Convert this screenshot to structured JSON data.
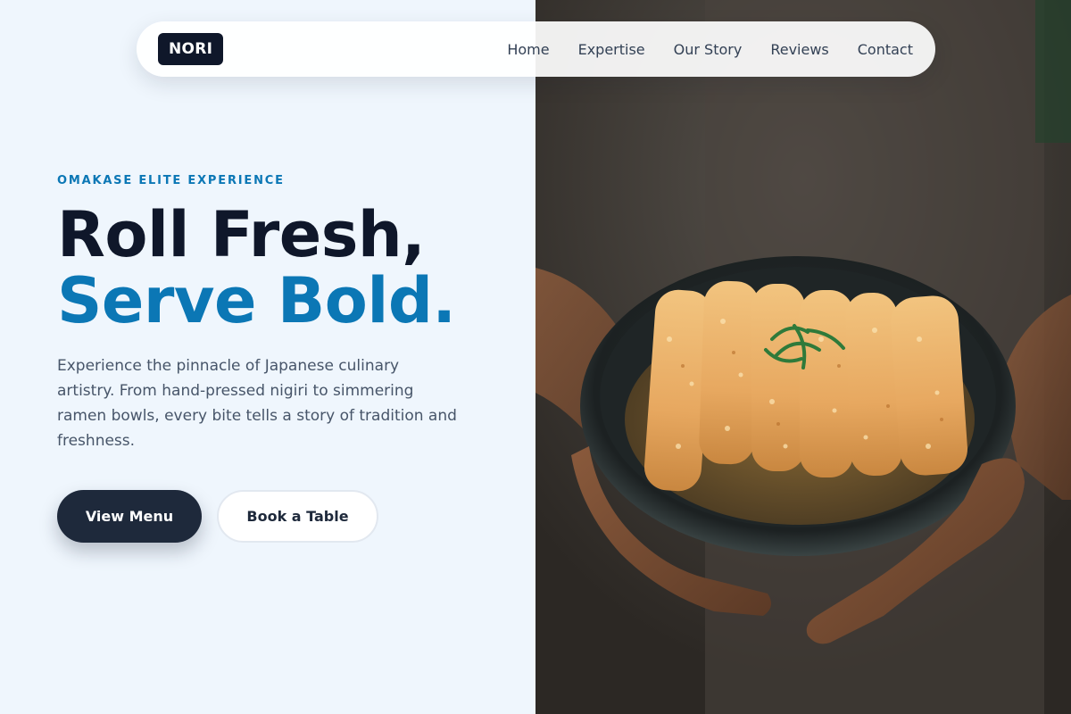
{
  "brand": {
    "logo_text": "NORI"
  },
  "nav": {
    "links": [
      {
        "label": "Home"
      },
      {
        "label": "Expertise"
      },
      {
        "label": "Our Story"
      },
      {
        "label": "Reviews"
      },
      {
        "label": "Contact"
      }
    ]
  },
  "hero": {
    "eyebrow": "OMAKASE ELITE EXPERIENCE",
    "headline_line1": "Roll Fresh,",
    "headline_line2": "Serve Bold.",
    "description": "Experience the pinnacle of Japanese culinary artistry. From hand-pressed nigiri to simmering ramen bowls, every bite tells a story of tradition and freshness.",
    "primary_cta": "View Menu",
    "secondary_cta": "Book a Table"
  },
  "colors": {
    "navy": "#0f172a",
    "accent_blue": "#0b77b5",
    "background": "#eff6fd",
    "body_text": "#475569"
  }
}
